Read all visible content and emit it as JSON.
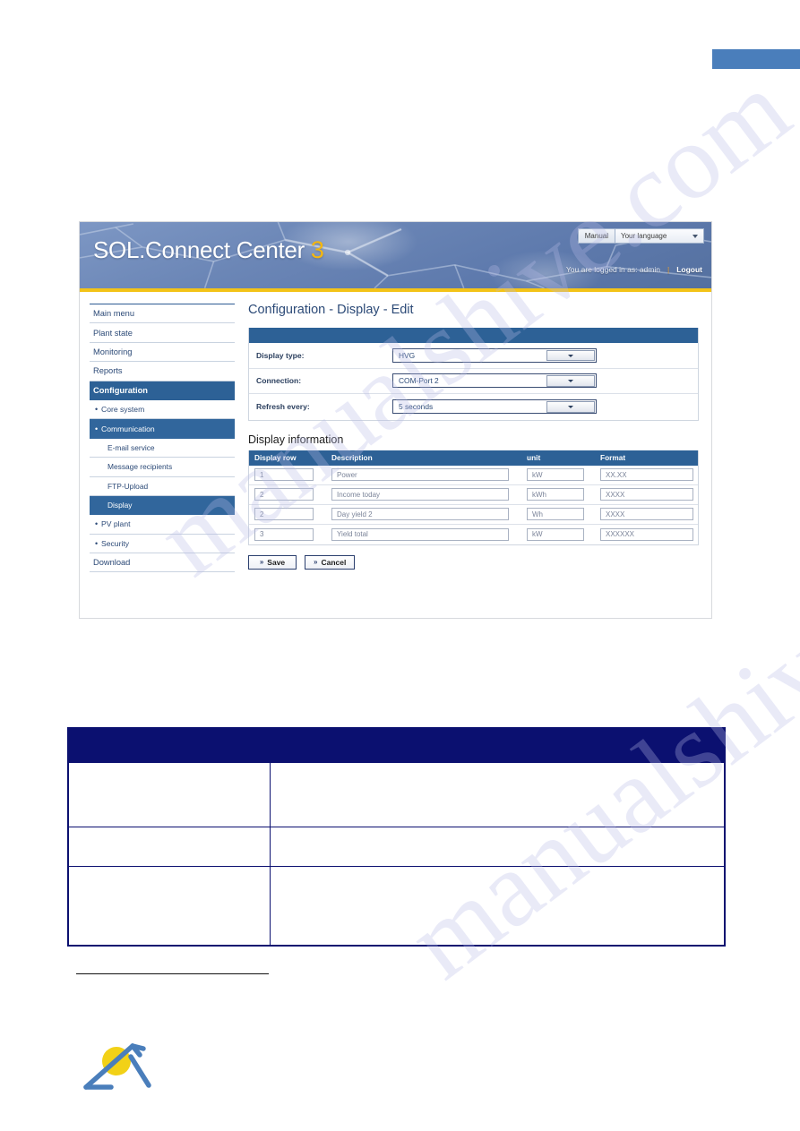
{
  "app": {
    "logo_text": "SOL.Connect Center",
    "logo_number": "3",
    "manual_label": "Manual",
    "language_value": "Your language",
    "login_status": "You are logged in as: admin",
    "login_separator": "|",
    "logout_label": "Logout"
  },
  "sidebar": {
    "items": [
      {
        "label": "Main menu",
        "level": 0,
        "state": "normal"
      },
      {
        "label": "Plant state",
        "level": 0,
        "state": "normal"
      },
      {
        "label": "Monitoring",
        "level": 0,
        "state": "normal"
      },
      {
        "label": "Reports",
        "level": 0,
        "state": "normal"
      },
      {
        "label": "Configuration",
        "level": 0,
        "state": "section"
      },
      {
        "label": "Core system",
        "level": 1,
        "state": "normal"
      },
      {
        "label": "Communication",
        "level": 1,
        "state": "active"
      },
      {
        "label": "E-mail service",
        "level": 2,
        "state": "normal"
      },
      {
        "label": "Message recipients",
        "level": 2,
        "state": "normal"
      },
      {
        "label": "FTP-Upload",
        "level": 2,
        "state": "normal"
      },
      {
        "label": "Display",
        "level": 2,
        "state": "active"
      },
      {
        "label": "PV plant",
        "level": 1,
        "state": "normal"
      },
      {
        "label": "Security",
        "level": 1,
        "state": "normal"
      },
      {
        "label": "Download",
        "level": 0,
        "state": "normal"
      }
    ]
  },
  "page": {
    "title": "Configuration - Display - Edit",
    "section_title": "Display information"
  },
  "form": {
    "fields": [
      {
        "label": "Display type:",
        "value": "HVG"
      },
      {
        "label": "Connection:",
        "value": "COM-Port 2"
      },
      {
        "label": "Refresh every:",
        "value": "5 seconds"
      }
    ]
  },
  "table": {
    "headers": [
      "Display row",
      "Description",
      "unit",
      "Format"
    ],
    "rows": [
      {
        "row": "1",
        "description": "Power",
        "unit": "kW",
        "format": "XX.XX"
      },
      {
        "row": "2",
        "description": "Income today",
        "unit": "kWh",
        "format": "XXXX"
      },
      {
        "row": "2",
        "description": "Day yield 2",
        "unit": "Wh",
        "format": "XXXX"
      },
      {
        "row": "3",
        "description": "Yield total",
        "unit": "kW",
        "format": "XXXXXX"
      }
    ]
  },
  "buttons": {
    "chevron": "»",
    "save_label": "Save",
    "cancel_label": "Cancel"
  },
  "lower_table": {
    "header_cells": [
      "",
      ""
    ],
    "rows": [
      {
        "label": "",
        "text": ""
      },
      {
        "label": "",
        "text": ""
      },
      {
        "label": "",
        "text": ""
      }
    ]
  },
  "watermark": {
    "text": "manualshive.com"
  },
  "colors": {
    "header_blue": "#2d6196",
    "accent_yellow": "#f3c318",
    "logo_number": "#f5b70f",
    "navy": "#0b1070",
    "topbar_accent": "#4a7ebb"
  }
}
